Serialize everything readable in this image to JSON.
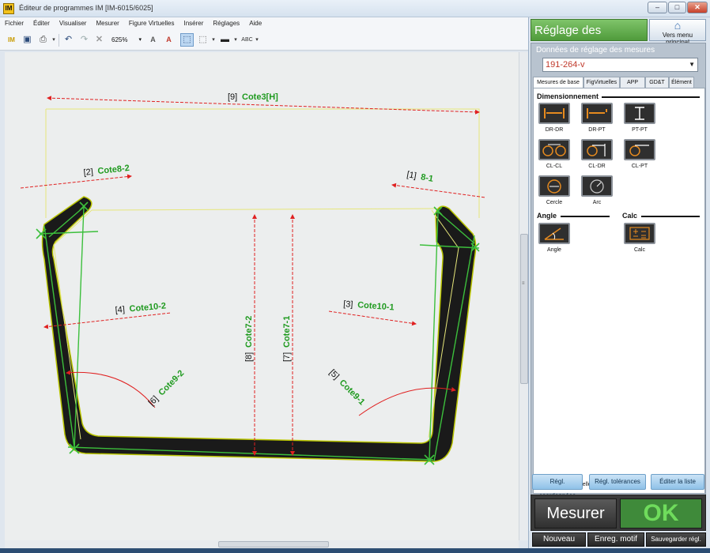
{
  "window": {
    "title": "Éditeur de programmes IM  [IM-6015/6025]",
    "app_icon": "IM",
    "controls": [
      "minimize-icon",
      "maximize-icon",
      "close-icon"
    ],
    "control_glyphs": {
      "minimize": "–",
      "maximize": "□",
      "close": "✕"
    }
  },
  "menu": [
    "Fichier",
    "Éditer",
    "Visualiser",
    "Mesurer",
    "Figure Virtuelles",
    "Insérer",
    "Réglages",
    "Aide"
  ],
  "toolbar": {
    "zoom": "625%",
    "icons": [
      "im-logo-icon",
      "save-icon",
      "print-icon",
      "undo-icon",
      "redo-icon",
      "delete-icon",
      "text-style-icon",
      "text-color-icon",
      "select-pointer-icon",
      "zoom-area-icon",
      "shape-select-icon",
      "line-color-icon",
      "line-style-icon"
    ],
    "text_icon_label": "ABC"
  },
  "canvas": {
    "labels": [
      {
        "id": "[9]",
        "name": "Cote3[H]"
      },
      {
        "id": "[2]",
        "name": "Cote8-2"
      },
      {
        "id": "[1]",
        "name": "8-1"
      },
      {
        "id": "[4]",
        "name": "Cote10-2"
      },
      {
        "id": "[3]",
        "name": "Cote10-1"
      },
      {
        "id": "[8]",
        "name": "Cote7-2"
      },
      {
        "id": "[7]",
        "name": "Cote7-1"
      },
      {
        "id": "[6]",
        "name": "Cote9-2"
      },
      {
        "id": "[5]",
        "name": "Cote9-1"
      }
    ]
  },
  "right_panel": {
    "title": "Réglage des mesures",
    "home_button": "Vers menu principal",
    "data_label": "Données de réglage des mesures",
    "program": "191-264-v",
    "tabs": [
      "Mesures de base",
      "FigVirtuelles",
      "APP",
      "GD&T",
      "Élément"
    ],
    "sections": {
      "dimension": "Dimensionnement",
      "angle": "Angle",
      "calc": "Calc"
    },
    "dimension_buttons": [
      "DR-DR",
      "DR-PT",
      "PT-PT",
      "CL-CL",
      "CL-DR",
      "CL-PT",
      "Cercle",
      "Arc"
    ],
    "angle_buttons": [
      "Angle"
    ],
    "calc_buttons": [
      "Calc"
    ],
    "manual_measure": "Mesure manuelle",
    "action_buttons": [
      "Régl. coordonnées",
      "Régl. tolérances",
      "Éditer la liste"
    ],
    "measure_button": "Mesurer",
    "ok_button": "OK",
    "bottom_buttons": [
      "Nouveau",
      "Enreg. motif",
      "Sauvegarder régl."
    ]
  },
  "colors": {
    "title_green": "#4f9b3b",
    "ok_green": "#6fdc5c",
    "dimension_red": "#e02020",
    "label_green": "#1f9a1f"
  }
}
